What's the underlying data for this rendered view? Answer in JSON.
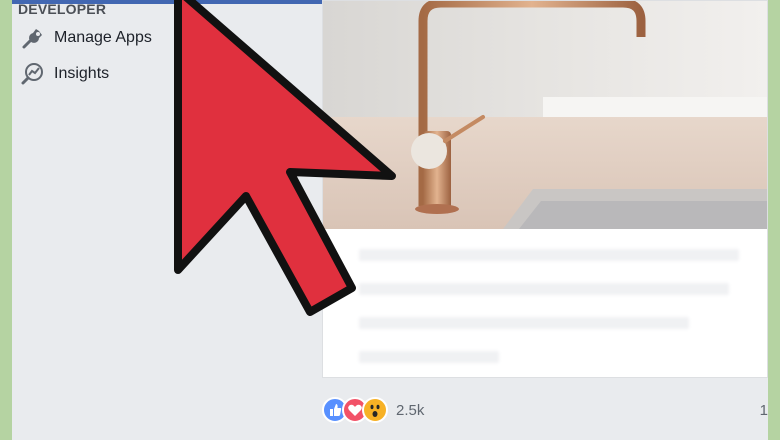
{
  "sidebar": {
    "section_header": "DEVELOPER",
    "items": [
      {
        "label": "Manage Apps",
        "icon": "wrench-icon"
      },
      {
        "label": "Insights",
        "icon": "insights-icon"
      }
    ]
  },
  "post": {
    "photo_subject": "rose-gold kitchen faucet",
    "reactions": [
      "like",
      "love",
      "wow"
    ],
    "reaction_count": "2.5k",
    "right_count": "1"
  },
  "colors": {
    "accent_blue": "#4267b2",
    "arrow_red": "#e0303e",
    "background_green": "#b5d3a2"
  }
}
